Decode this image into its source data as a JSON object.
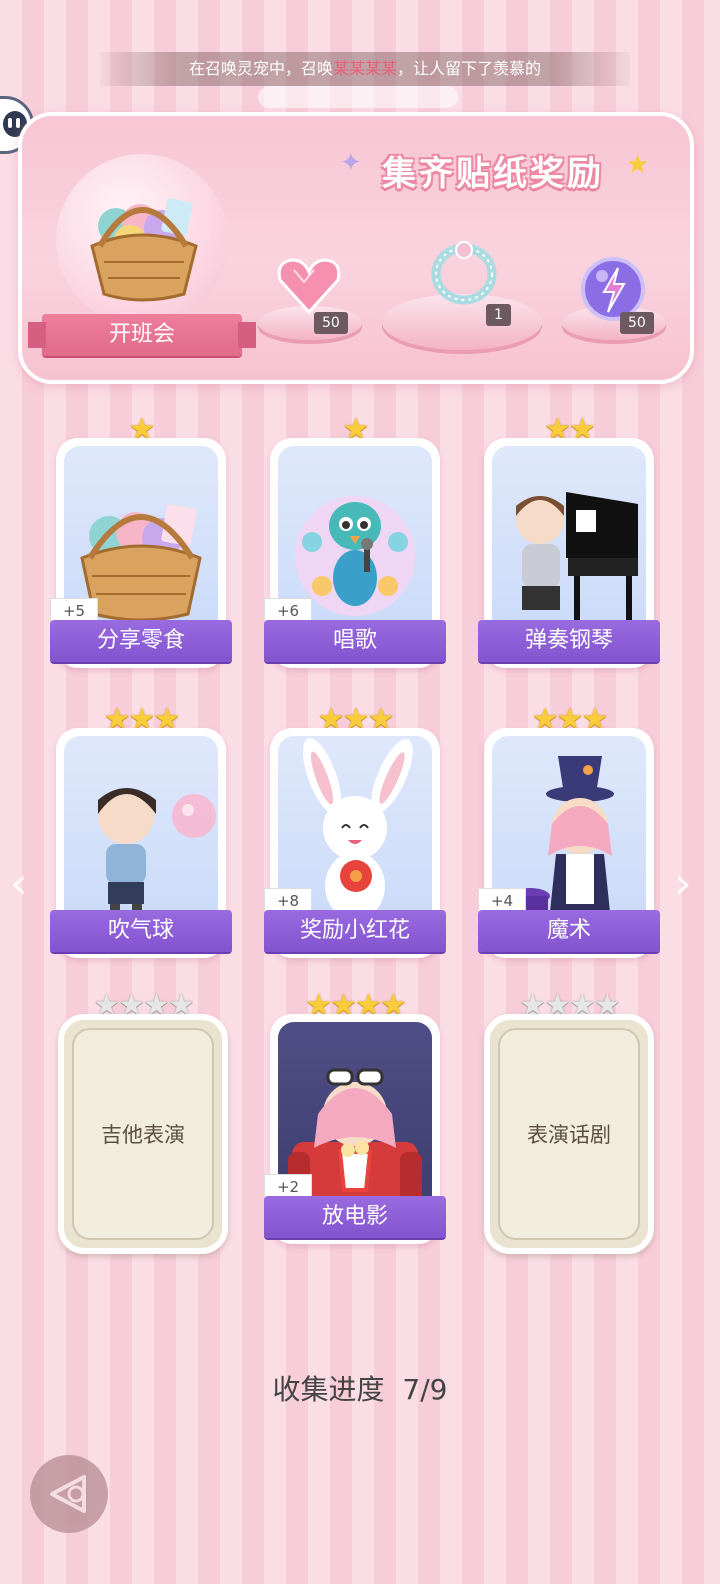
{
  "marquee": {
    "prefix": "在召唤灵宠中，召唤",
    "highlight": "某某某某",
    "suffix": "，让人留下了羡慕的"
  },
  "banner": {
    "title": "集齐贴纸奖励",
    "event_label": "开班会",
    "rewards": [
      {
        "icon": "pink-heart-gem-icon",
        "count": "50"
      },
      {
        "icon": "crystal-ring-icon",
        "count": "1"
      },
      {
        "icon": "purple-orb-icon",
        "count": "50"
      }
    ]
  },
  "cards": [
    {
      "label": "分享零食",
      "stars": 1,
      "max_stars": 1,
      "bonus": "+5",
      "collected": true,
      "icon": "snack-basket-icon"
    },
    {
      "label": "唱歌",
      "stars": 1,
      "max_stars": 1,
      "bonus": "+6",
      "collected": true,
      "icon": "peacock-singing-icon"
    },
    {
      "label": "弹奏钢琴",
      "stars": 2,
      "max_stars": 2,
      "bonus": "",
      "collected": true,
      "icon": "boy-piano-icon"
    },
    {
      "label": "吹气球",
      "stars": 3,
      "max_stars": 3,
      "bonus": "",
      "collected": true,
      "icon": "boy-bubblegum-icon"
    },
    {
      "label": "奖励小红花",
      "stars": 3,
      "max_stars": 3,
      "bonus": "+8",
      "collected": true,
      "icon": "bunny-flower-icon"
    },
    {
      "label": "魔术",
      "stars": 3,
      "max_stars": 3,
      "bonus": "+4",
      "collected": true,
      "icon": "girl-magician-icon"
    },
    {
      "label": "吉他表演",
      "stars": 0,
      "max_stars": 4,
      "bonus": "",
      "collected": false,
      "icon": ""
    },
    {
      "label": "放电影",
      "stars": 4,
      "max_stars": 4,
      "bonus": "+2",
      "collected": true,
      "icon": "girl-popcorn-icon"
    },
    {
      "label": "表演话剧",
      "stars": 0,
      "max_stars": 4,
      "bonus": "",
      "collected": false,
      "icon": ""
    }
  ],
  "progress": {
    "label": "收集进度",
    "value": "7/9"
  },
  "colors": {
    "label_purple": "#8a5ad4",
    "star_gold": "#f8cc3a",
    "banner_pink": "#ee7f9c"
  }
}
